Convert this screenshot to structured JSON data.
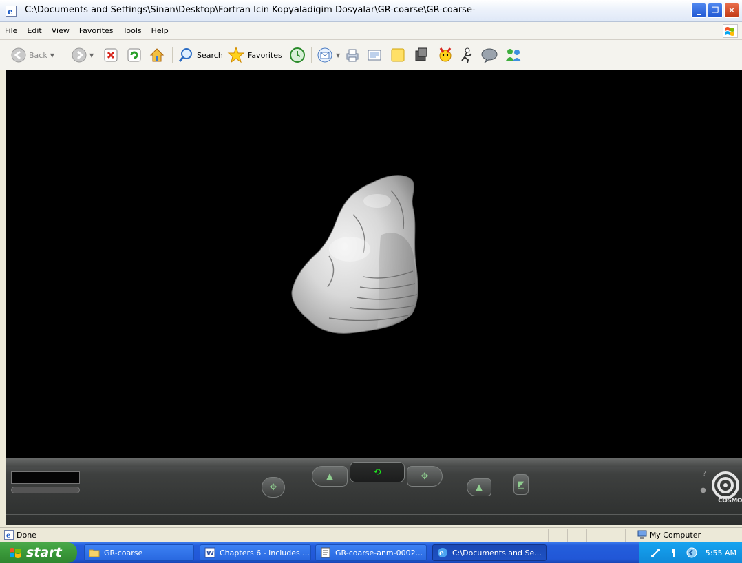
{
  "window": {
    "title": "C:\\Documents and Settings\\Sinan\\Desktop\\Fortran Icin Kopyaladigim Dosyalar\\GR-coarse\\GR-coarse-",
    "buttons": [
      "minimize",
      "restore",
      "close"
    ]
  },
  "menu": [
    "File",
    "Edit",
    "View",
    "Favorites",
    "Tools",
    "Help"
  ],
  "toolbar": {
    "back_label": "Back",
    "search_label": "Search",
    "favorites_label": "Favorites"
  },
  "status": {
    "text": "Done",
    "zone": "My Computer"
  },
  "taskbar": {
    "start_label": "start",
    "tasks": [
      {
        "label": "GR-coarse",
        "icon": "folder-icon"
      },
      {
        "label": "Chapters 6 - includes ...",
        "icon": "word-doc-icon"
      },
      {
        "label": "GR-coarse-anm-0002...",
        "icon": "notepad-icon"
      },
      {
        "label": "C:\\Documents and Se...",
        "icon": "ie-icon",
        "active": true
      }
    ],
    "clock": "5:55 AM"
  },
  "cosmo": {
    "logo_text": "COSMO"
  },
  "colors": {
    "viewport_bg": "#000000",
    "taskbar_blue": "#245edc",
    "start_green": "#3c9c3c",
    "active_tool_green": "#1fe61f"
  }
}
